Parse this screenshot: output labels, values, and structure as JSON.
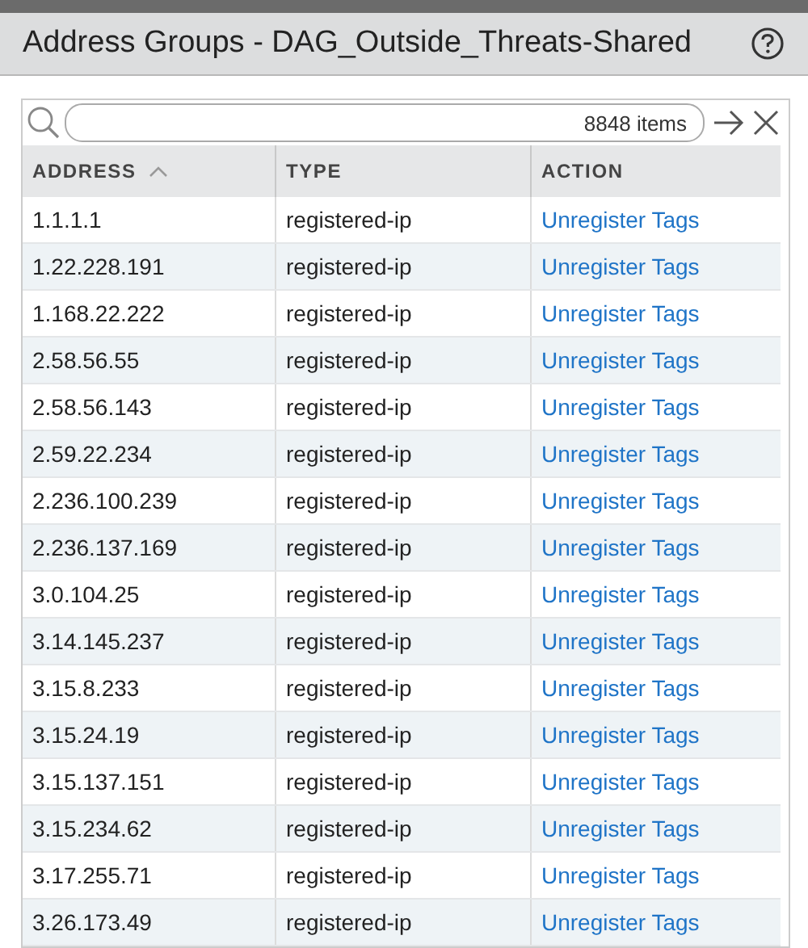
{
  "window": {
    "title": "Address Groups - DAG_Outside_Threats-Shared"
  },
  "search": {
    "count": "8848 items"
  },
  "table": {
    "columns": [
      {
        "label": "ADDRESS",
        "sorted": true
      },
      {
        "label": "TYPE",
        "sorted": false
      },
      {
        "label": "ACTION",
        "sorted": false
      }
    ],
    "rows": [
      {
        "address": "1.1.1.1",
        "type": "registered-ip",
        "action": "Unregister Tags"
      },
      {
        "address": "1.22.228.191",
        "type": "registered-ip",
        "action": "Unregister Tags"
      },
      {
        "address": "1.168.22.222",
        "type": "registered-ip",
        "action": "Unregister Tags"
      },
      {
        "address": "2.58.56.55",
        "type": "registered-ip",
        "action": "Unregister Tags"
      },
      {
        "address": "2.58.56.143",
        "type": "registered-ip",
        "action": "Unregister Tags"
      },
      {
        "address": "2.59.22.234",
        "type": "registered-ip",
        "action": "Unregister Tags"
      },
      {
        "address": "2.236.100.239",
        "type": "registered-ip",
        "action": "Unregister Tags"
      },
      {
        "address": "2.236.137.169",
        "type": "registered-ip",
        "action": "Unregister Tags"
      },
      {
        "address": "3.0.104.25",
        "type": "registered-ip",
        "action": "Unregister Tags"
      },
      {
        "address": "3.14.145.237",
        "type": "registered-ip",
        "action": "Unregister Tags"
      },
      {
        "address": "3.15.8.233",
        "type": "registered-ip",
        "action": "Unregister Tags"
      },
      {
        "address": "3.15.24.19",
        "type": "registered-ip",
        "action": "Unregister Tags"
      },
      {
        "address": "3.15.137.151",
        "type": "registered-ip",
        "action": "Unregister Tags"
      },
      {
        "address": "3.15.234.62",
        "type": "registered-ip",
        "action": "Unregister Tags"
      },
      {
        "address": "3.17.255.71",
        "type": "registered-ip",
        "action": "Unregister Tags"
      },
      {
        "address": "3.26.173.49",
        "type": "registered-ip",
        "action": "Unregister Tags"
      }
    ]
  }
}
